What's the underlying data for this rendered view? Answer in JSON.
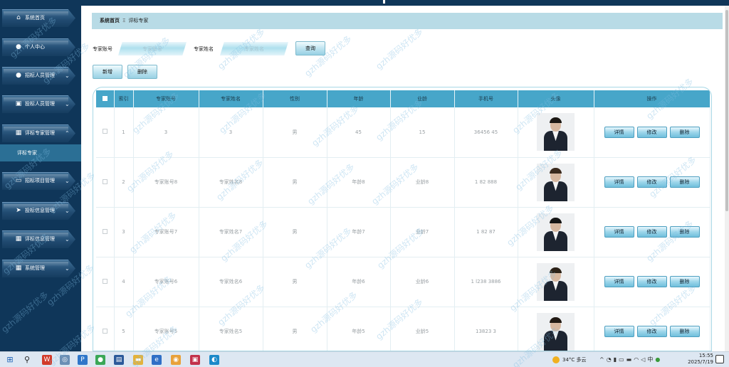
{
  "sidebar": {
    "items": [
      {
        "label": "系统首页",
        "icon": "home-icon",
        "glyph": "⌂",
        "expanded": false
      },
      {
        "label": "个人中心",
        "icon": "user-icon",
        "glyph": "●",
        "expanded": false
      },
      {
        "label": "招标人员管理",
        "icon": "user-icon",
        "glyph": "●",
        "expanded": false
      },
      {
        "label": "投标人员管理",
        "icon": "image-icon",
        "glyph": "▣",
        "expanded": false
      },
      {
        "label": "评标专家管理",
        "icon": "grid-icon",
        "glyph": "▦",
        "expanded": true
      },
      {
        "label": "招标项目管理",
        "icon": "monitor-icon",
        "glyph": "▭",
        "expanded": false
      },
      {
        "label": "投标信息管理",
        "icon": "send-icon",
        "glyph": "➤",
        "expanded": false
      },
      {
        "label": "评标信息管理",
        "icon": "grid-icon",
        "glyph": "▦",
        "expanded": false
      },
      {
        "label": "系统管理",
        "icon": "grid-icon",
        "glyph": "▦",
        "expanded": false
      }
    ],
    "active_sub": "评标专家"
  },
  "breadcrumb": {
    "home": "系统首页",
    "separator": "Ξ",
    "current": "评标专家"
  },
  "search": {
    "account_label": "专家账号",
    "account_placeholder": "专家账号",
    "name_label": "专家姓名",
    "name_placeholder": "专家姓名",
    "query_button": "查询"
  },
  "actions": {
    "add": "新增",
    "delete": "删除"
  },
  "table": {
    "headers": [
      "索引",
      "专家账号",
      "专家姓名",
      "性别",
      "年龄",
      "业龄",
      "手机号",
      "头像",
      "操作"
    ],
    "rows": [
      {
        "index": "1",
        "account": "3",
        "name": "3",
        "gender": "男",
        "age": "45",
        "years": "15",
        "phone": "36456   45"
      },
      {
        "index": "2",
        "account": "专家账号8",
        "name": "专家姓名8",
        "gender": "男",
        "age": "年龄8",
        "years": "业龄8",
        "phone": "1 82    888"
      },
      {
        "index": "3",
        "account": "专家账号7",
        "name": "专家姓名7",
        "gender": "男",
        "age": "年龄7",
        "years": "业龄7",
        "phone": "1 82    87"
      },
      {
        "index": "4",
        "account": "专家账号6",
        "name": "专家姓名6",
        "gender": "男",
        "age": "年龄6",
        "years": "业龄6",
        "phone": "1 l238 3886"
      },
      {
        "index": "5",
        "account": "专家账号5",
        "name": "专家姓名5",
        "gender": "男",
        "age": "年龄5",
        "years": "业龄5",
        "phone": "13823    3"
      }
    ],
    "row_buttons": {
      "detail": "详情",
      "edit": "修改",
      "delete": "删除"
    }
  },
  "watermark": "gzh源码好优多",
  "taskbar": {
    "temperature": "34°C",
    "weather": "多云",
    "tray_ime": "中",
    "time": "15:55",
    "date": "2025/7/19"
  },
  "colors": {
    "sidebar": "#0f3659",
    "breadcrumb": "#b8dbe6",
    "table_header": "#47a6c9",
    "accent": "#2b6f95"
  }
}
